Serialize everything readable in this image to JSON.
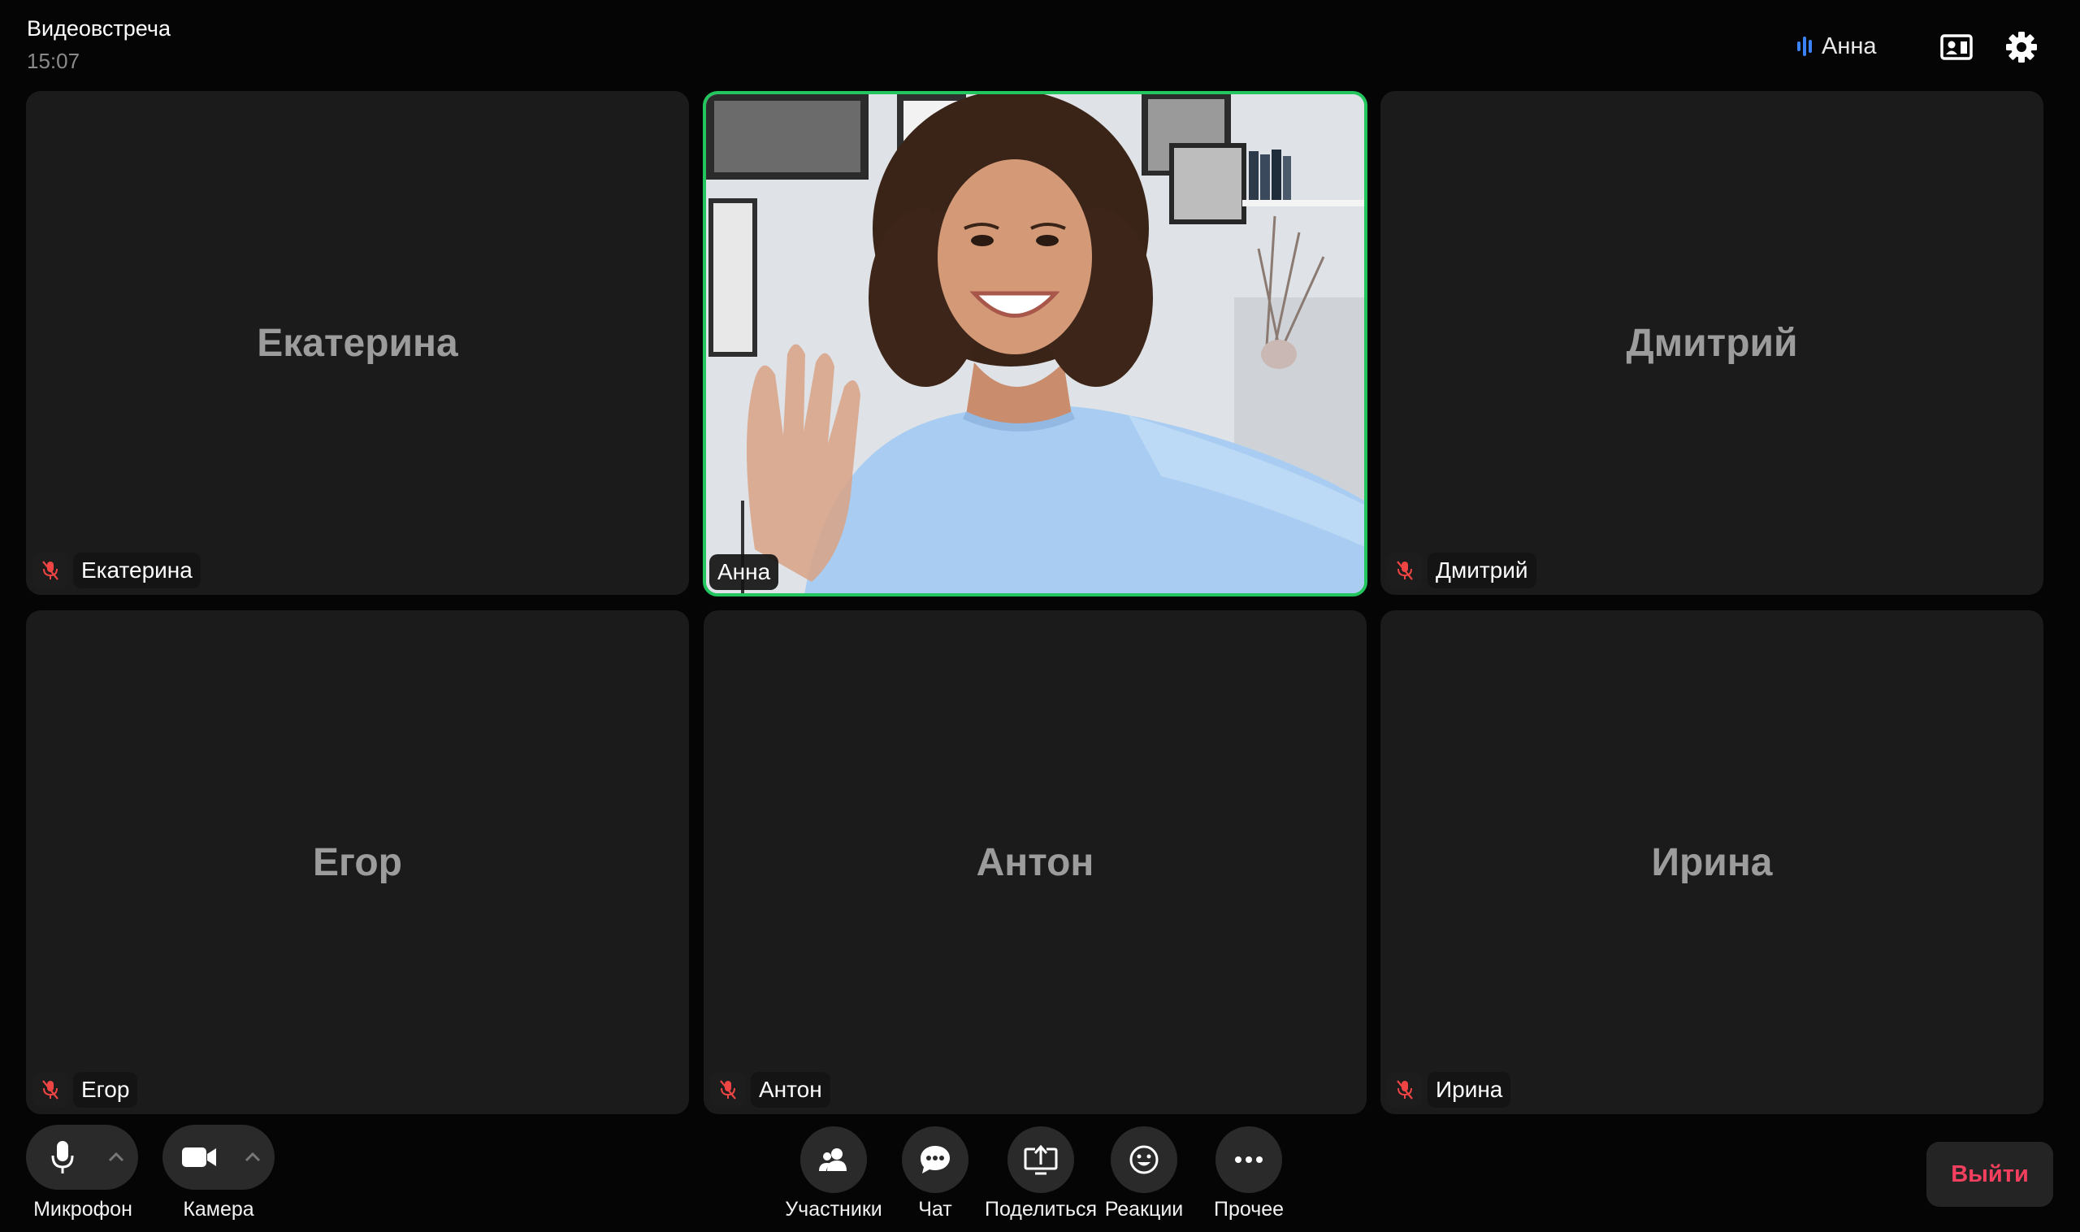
{
  "header": {
    "title": "Видеовстреча",
    "time": "15:07",
    "active_speaker": "Анна"
  },
  "participants": [
    {
      "name": "Екатерина",
      "muted": true,
      "video": false
    },
    {
      "name": "Анна",
      "muted": false,
      "video": true,
      "speaking": true
    },
    {
      "name": "Дмитрий",
      "muted": true,
      "video": false
    },
    {
      "name": "Егор",
      "muted": true,
      "video": false
    },
    {
      "name": "Антон",
      "muted": true,
      "video": false
    },
    {
      "name": "Ирина",
      "muted": true,
      "video": false
    }
  ],
  "toolbar": {
    "microphone_label": "Микрофон",
    "camera_label": "Камера",
    "participants_label": "Участники",
    "chat_label": "Чат",
    "share_label": "Поделиться",
    "reactions_label": "Реакции",
    "more_label": "Прочее",
    "leave_label": "Выйти"
  },
  "icons": {
    "header": [
      "audio-wave-icon",
      "contact-card-icon",
      "gear-icon"
    ],
    "tiles": [
      "mic-off-icon"
    ],
    "toolbar": [
      "microphone-icon",
      "chevron-up-icon",
      "video-camera-icon",
      "people-icon",
      "chat-bubble-icon",
      "screen-share-icon",
      "smiley-icon",
      "more-dots-icon"
    ]
  },
  "colors": {
    "background": "#050505",
    "tile": "#1b1b1b",
    "active_border": "#22c55e",
    "speaker_wave": "#3b82f6",
    "mute": "#ef4444",
    "leave_text": "#f43f5e"
  }
}
